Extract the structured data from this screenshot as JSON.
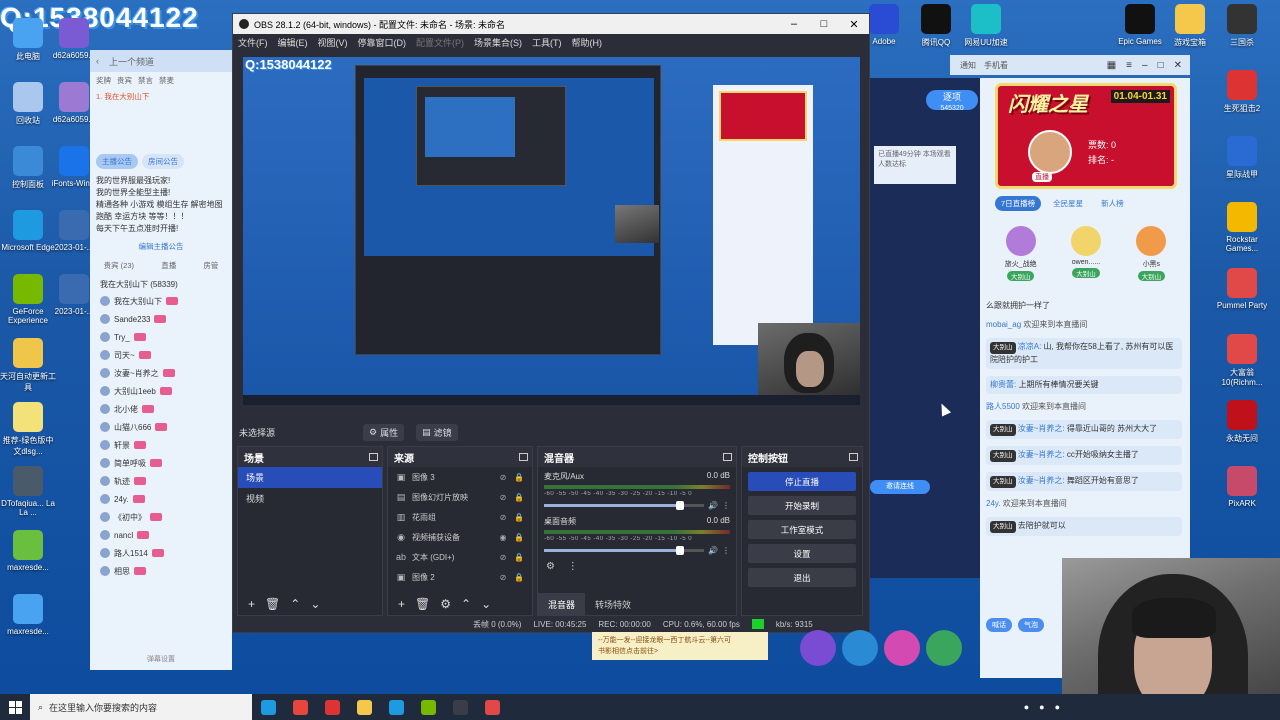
{
  "desktop": {
    "qq_banner": "Q:1538044122",
    "icons_left": [
      {
        "label": "此电脑",
        "color": "#4aa3f0"
      },
      {
        "label": "回收站",
        "color": "#aac8ee"
      },
      {
        "label": "控制面板",
        "color": "#3a8ad8"
      },
      {
        "label": "Microsoft Edge",
        "color": "#1e9be0"
      },
      {
        "label": "GeForce Experience",
        "color": "#76b900"
      },
      {
        "label": "天河自动更新工具",
        "color": "#f0c64a"
      },
      {
        "label": "推荐-绿色版中文dlsg...",
        "color": "#f3e27a"
      },
      {
        "label": "DTofaqiua... La La ...",
        "color": "#4a5a6a"
      },
      {
        "label": "maxresde...",
        "color": "#6bbf3f"
      },
      {
        "label": "maxresde...",
        "color": "#4aa3f0"
      }
    ],
    "icons_col2": [
      {
        "label": "d62a6059...",
        "color": "#7a5bd3"
      },
      {
        "label": "d62a6059...",
        "color": "#9a7ad3"
      },
      {
        "label": "iFonts-Win...",
        "color": "#1a73e8"
      },
      {
        "label": "2023-01-...",
        "color": "#3a6ab0"
      },
      {
        "label": "2023-01-...",
        "color": "#3a6ab0"
      }
    ],
    "icons_right": [
      {
        "label": "Adobe",
        "color": "#2a4bd3"
      },
      {
        "label": "腾讯QQ",
        "color": "#111"
      },
      {
        "label": "网易UU加速",
        "color": "#1dbfc6"
      },
      {
        "label": "Epic Games",
        "color": "#111"
      },
      {
        "label": "游戏宝箱",
        "color": "#f5c74a"
      },
      {
        "label": "三国杀",
        "color": "#333"
      },
      {
        "label": "生死狙击2",
        "color": "#d33"
      },
      {
        "label": "星际战甲",
        "color": "#2a6ad3"
      },
      {
        "label": "Rockstar Games...",
        "color": "#f5b800"
      },
      {
        "label": "Pummel Party",
        "color": "#e14848"
      },
      {
        "label": "大富翁10(Richm...",
        "color": "#e14848"
      },
      {
        "label": "永劫无间",
        "color": "#c0101a"
      },
      {
        "label": "PixARK",
        "color": "#c84a6a"
      }
    ]
  },
  "obs": {
    "title": "OBS 28.1.2 (64-bit, windows) - 配置文件: 未命名 - 场景: 未命名",
    "menu": [
      "文件(F)",
      "编辑(E)",
      "视图(V)",
      "停靠窗口(D)",
      "配置文件(P)",
      "场景集合(S)",
      "工具(T)",
      "帮助(H)"
    ],
    "preview_qq": "Q:1538044122",
    "no_source_selected": "未选择源",
    "properties_tab": "属性",
    "filters_tab": "滤镜",
    "scenes": {
      "title": "场景",
      "items": [
        "场景",
        "视频"
      ]
    },
    "sources": {
      "title": "来源",
      "items": [
        {
          "icon": "image-icon",
          "glyph": "▣",
          "name": "图像 3"
        },
        {
          "icon": "slideshow-icon",
          "glyph": "▤",
          "name": "图像幻灯片放映"
        },
        {
          "icon": "brush-icon",
          "glyph": "▥",
          "name": "花雨组"
        },
        {
          "icon": "camera-icon",
          "glyph": "◉",
          "name": "视频捕获设备"
        },
        {
          "icon": "text-icon",
          "glyph": "ab",
          "name": "文本 (GDI+)"
        },
        {
          "icon": "image-icon",
          "glyph": "▣",
          "name": "图像 2"
        }
      ]
    },
    "mixer": {
      "title": "混音器",
      "channels": [
        {
          "name": "麦克风/Aux",
          "db": "0.0 dB",
          "volume": 0.85
        },
        {
          "name": "桌面音频",
          "db": "0.0 dB",
          "volume": 0.85
        }
      ],
      "scale": "-60 -55 -50 -45 -40 -35 -30 -25 -20 -15 -10 -5 0",
      "tabs": [
        "混音器",
        "转场特效"
      ]
    },
    "controls": {
      "title": "控制按钮",
      "stop_stream": "停止直播",
      "start_record": "开始录制",
      "studio_mode": "工作室模式",
      "settings": "设置",
      "exit": "退出"
    },
    "status": {
      "dropped": "丢帧 0 (0.0%)",
      "live": "LIVE: 00:45:25",
      "rec": "REC: 00:00:00",
      "cpu": "CPU: 0.6%, 60.00 fps",
      "kbs": "kb/s: 9315"
    }
  },
  "room_left": {
    "top": [
      "上一个频道"
    ],
    "nav": [
      "奖牌",
      "贵宾",
      "禁言",
      "禁麦"
    ],
    "highlight": "1. 我在大别山下",
    "tabs": [
      "主播公告",
      "房间公告"
    ],
    "notice": [
      "我的世界服最强玩家!",
      "我的世界全能型主播!",
      "精通各种 小游戏 模组生存 解密地图",
      "跑酷 幸运方块 等等！！！",
      "每天下午五点准时开播!"
    ],
    "edit_notice": "编辑主播公告",
    "list_tabs": [
      "贵宾 (23)",
      "直播",
      "房管"
    ],
    "viewers_header": "我在大别山下 (58339)",
    "viewers": [
      "我在大别山下",
      "Sande233",
      "Try_",
      "司天~",
      "汝妻~肖养之",
      "大别山1eeb",
      "北小佬",
      "山猫八666",
      "轩景",
      "简单呼吸",
      "轨迹",
      "24y.",
      "《初中》",
      "nancl",
      "路人1514",
      "相思"
    ],
    "footer": "弹幕设置"
  },
  "room_right": {
    "top_bar": [
      "通知",
      "手机看"
    ],
    "hero_title": "闪耀之星",
    "hero_time": "01.04-01.31",
    "hero_votes": "票数: 0",
    "hero_rank": "排名: -",
    "hero_tag": "直播",
    "rank_tabs": [
      "7日直播榜",
      "全民星星",
      "新人榜"
    ],
    "podium": [
      {
        "name": "旅火_战绝",
        "tag": "大别山"
      },
      {
        "name": "owen......",
        "tag": "大别山"
      },
      {
        "name": "小黑s",
        "tag": "大别山"
      }
    ],
    "chat": [
      {
        "type": "sys",
        "text": "么跟就拥护一样了"
      },
      {
        "type": "welcome",
        "name": "mobai_ag",
        "text": "欢迎来到本直播间"
      },
      {
        "type": "msg",
        "lv": "大别山",
        "name": "凉凉A:",
        "text": "山, 我帮你在58上看了, 苏州有可以医院陪护的护工"
      },
      {
        "type": "msg",
        "lv": "",
        "name": "柳贵蕾:",
        "text": "上期所有棒情况要关键"
      },
      {
        "type": "welcome",
        "name": "路人5500",
        "text": "欢迎来到本直播间"
      },
      {
        "type": "msg",
        "lv": "大别山",
        "name": "汝妻~肖养之:",
        "text": "得靠近山哥的 苏州大大了"
      },
      {
        "type": "msg",
        "lv": "大别山",
        "name": "汝妻~肖养之:",
        "text": "cc开始吸纳女主播了"
      },
      {
        "type": "msg",
        "lv": "大别山",
        "name": "汝妻~肖养之:",
        "text": "舞蹈区开始有意思了"
      },
      {
        "type": "welcome",
        "name": "24y.",
        "text": "欢迎来到本直播间"
      },
      {
        "type": "msg",
        "lv": "大别山",
        "name": "",
        "text": "去陪护就可以"
      }
    ],
    "chat_btns": [
      "喊话",
      "气泡"
    ]
  },
  "middle": {
    "follow_label": "逐项",
    "follow_count": "545320",
    "msg": "已直播49分钟 本场观看人数达标",
    "btn2": "邀请连线"
  },
  "promo": {
    "line1": "--万能一发--迎接龙眼一西丁航斗云--第六可",
    "line2": "书影相信点击前往>"
  },
  "taskbar": {
    "search_placeholder": "在这里输入你要搜索的内容",
    "apps": [
      {
        "name": "edge-taskbar-icon",
        "color": "#1e9be0"
      },
      {
        "name": "chrome-taskbar-icon",
        "color": "#e8453c"
      },
      {
        "name": "app-red-taskbar-icon",
        "color": "#d33"
      },
      {
        "name": "explorer-taskbar-icon",
        "color": "#f5c74a"
      },
      {
        "name": "edge2-taskbar-icon",
        "color": "#1e9be0"
      },
      {
        "name": "nvidia-taskbar-icon",
        "color": "#76b900"
      },
      {
        "name": "obs-taskbar-icon",
        "color": "#3a3d48"
      },
      {
        "name": "netease-taskbar-icon",
        "color": "#e14848"
      }
    ]
  }
}
